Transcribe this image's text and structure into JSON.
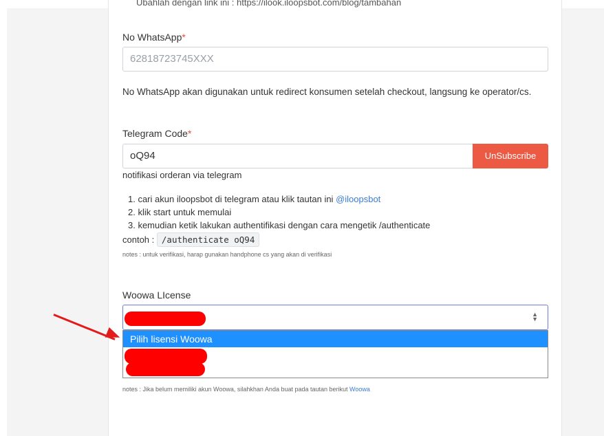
{
  "top_partial_text": "Ubahlah dengan link ini : https://ilook.iloopsbot.com/blog/tambahan",
  "whatsapp": {
    "label": "No WhatsApp",
    "required_mark": "*",
    "placeholder": "62818723745XXX",
    "help": "No WhatsApp akan digunakan untuk redirect konsumen setelah checkout, langsung ke operator/cs."
  },
  "telegram": {
    "label": "Telegram Code",
    "required_mark": "*",
    "value": "oQ94",
    "unsubscribe_label": "UnSubscribe",
    "help": "notifikasi orderan via telegram",
    "steps": {
      "s1_prefix": "1. cari akun iloopsbot di telegram atau klik tautan ini ",
      "s1_link": "@iloopsbot",
      "s2": "2. klik start untuk memulai",
      "s3": "3. kemudian ketik lakukan authentifikasi dengan cara mengetik /authenticate"
    },
    "example_label": "contoh :",
    "example_code": "/authenticate oQ94",
    "notes": "notes : untuk verifikasi, harap gunakan handphone cs yang akan di verifikasi"
  },
  "woowa": {
    "label": "Woowa LIcense",
    "selected_option": "Pilih lisensi Woowa",
    "notes_prefix": "notes : Jika belum memiliki akun Woowa, silahkhan Anda buat pada tautan berikut ",
    "notes_link": "Woowa"
  },
  "colors": {
    "required": "#e74c3c",
    "unsubscribe_bg": "#ec5a43",
    "link": "#3a7bd5",
    "option_highlight": "#1e90ff",
    "redaction": "#ff0000",
    "annotation_arrow": "#e21b1b"
  }
}
